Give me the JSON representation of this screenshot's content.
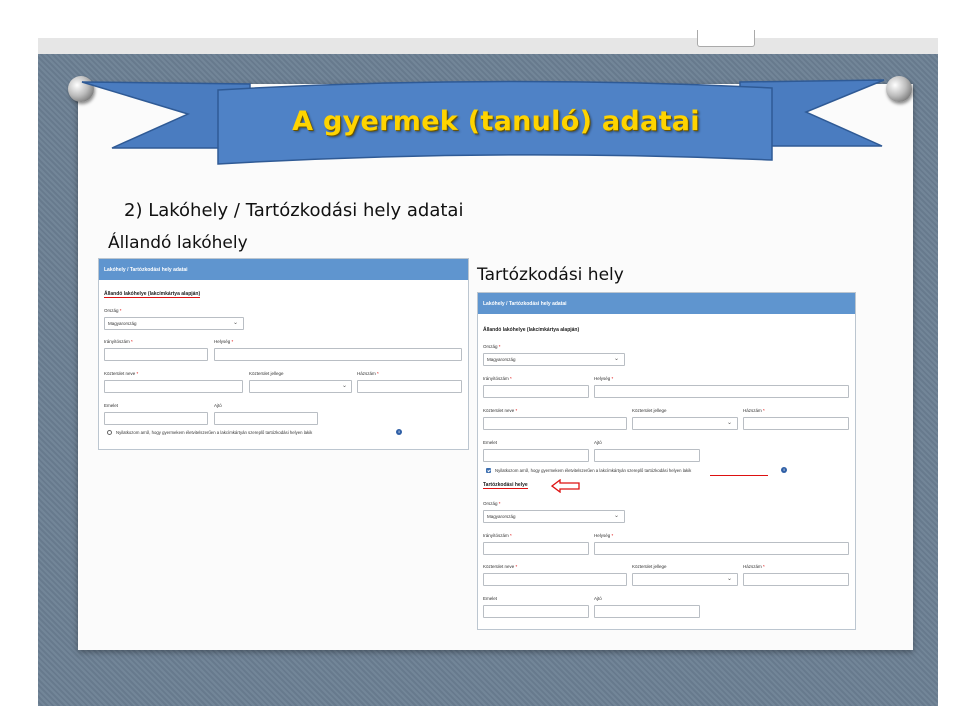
{
  "slide": {
    "title": "A gyermek (tanuló) adatai",
    "section_heading": "2)   Lakóhely / Tartózkodási hely adatai",
    "left_caption": "Állandó lakóhely",
    "right_caption": "Tartózkodási hely"
  },
  "left_form": {
    "header": "Lakóhely / Tartózkodási hely adatai",
    "section_title": "Állandó lakóhelye (lakcímkártya alapján)",
    "country_label": "Ország",
    "country_value": "Magyarország",
    "zip_label": "Irányítószám",
    "city_label": "Helység",
    "street_label": "Közterület neve",
    "street_type_label": "Közterület jellege",
    "house_label": "Házszám",
    "floor_label": "Emelet",
    "door_label": "Ajtó",
    "checkbox_text": "Nyilatkozom arról, hogy gyermekem életvitelszerűen a lakcímkártyán szereplő tartózkodási helyen lakik",
    "required_mark": "*",
    "info_glyph": "i"
  },
  "right_form": {
    "header": "Lakóhely / Tartózkodási hely adatai",
    "section_title": "Állandó lakóhelye (lakcímkártya alapján)",
    "country_label": "Ország",
    "country_value": "Magyarország",
    "zip_label": "Irányítószám",
    "city_label": "Helység",
    "street_label": "Közterület neve",
    "street_type_label": "Közterület jellege",
    "house_label": "Házszám",
    "floor_label": "Emelet",
    "door_label": "Ajtó",
    "checkbox_text": "Nyilatkozom arról, hogy gyermekem életvitelszerűen a lakcímkártyán szereplő tartózkodási helyen lakik",
    "checkbox_checked": true,
    "section2_title": "Tartózkodási helye",
    "country2_label": "Ország",
    "country2_value": "Magyarország",
    "zip2_label": "Irányítószám",
    "city2_label": "Helység",
    "street2_label": "Közterület neve",
    "street2_type_label": "Közterület jellege",
    "house2_label": "Házszám",
    "floor2_label": "Emelet",
    "door2_label": "Ajtó",
    "required_mark": "*",
    "info_glyph": "i"
  },
  "colors": {
    "ribbon": "#4a7cc0",
    "title_text": "#ffd400",
    "form_header": "#5f95cf",
    "annotation_red": "#d11111"
  }
}
